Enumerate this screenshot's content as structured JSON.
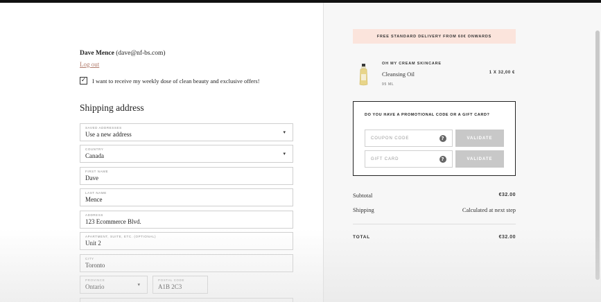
{
  "account": {
    "name": "Dave Mence",
    "email": "(dave@nf-bs.com)",
    "logout_label": "Log out"
  },
  "newsletter": {
    "checked": true,
    "check_glyph": "✓",
    "label": "I want to receive my weekly dose of clean beauty and exclusive offers!"
  },
  "shipping": {
    "title": "Shipping address",
    "fields": {
      "saved_addresses": {
        "label": "SAVED ADDRESSES",
        "value": "Use a new address"
      },
      "country": {
        "label": "COUNTRY",
        "value": "Canada"
      },
      "first_name": {
        "label": "FIRST NAME",
        "value": "Dave"
      },
      "last_name": {
        "label": "LAST NAME",
        "value": "Mence"
      },
      "address": {
        "label": "ADDRESS",
        "value": "123 Ecommerce Blvd."
      },
      "apartment": {
        "label": "APARTMENT, SUITE, ETC. (OPTIONAL)",
        "value": "Unit 2"
      },
      "city": {
        "label": "CITY",
        "value": "Toronto"
      },
      "province": {
        "label": "PROVINCE",
        "value": "Ontario"
      },
      "postal_code": {
        "label": "POSTAL CODE",
        "value": "A1B 2C3"
      }
    },
    "chevron_glyph": "▾"
  },
  "banner": {
    "text": "FREE STANDARD DELIVERY FROM 60€ ONWARDS"
  },
  "cart_item": {
    "brand": "OH MY CREAM SKINCARE",
    "name": "Cleansing Oil",
    "volume": "95 ML",
    "qty_price": "1 X 32,00 €"
  },
  "promo": {
    "question": "DO YOU HAVE A PROMOTIONAL CODE OR A GIFT CARD?",
    "coupon_placeholder": "COUPON CODE",
    "giftcard_placeholder": "GIFT CARD",
    "help_glyph": "?",
    "validate_label": "VALIDATE"
  },
  "summary": {
    "subtotal_label": "Subtotal",
    "subtotal_value": "€32.00",
    "shipping_label": "Shipping",
    "shipping_value": "Calculated at next step",
    "total_label": "TOTAL",
    "total_value": "€32.00"
  },
  "colors": {
    "accent_link": "#b07a6a",
    "banner_bg": "#fbe4dc",
    "validate_bg": "#c8c8c8"
  }
}
